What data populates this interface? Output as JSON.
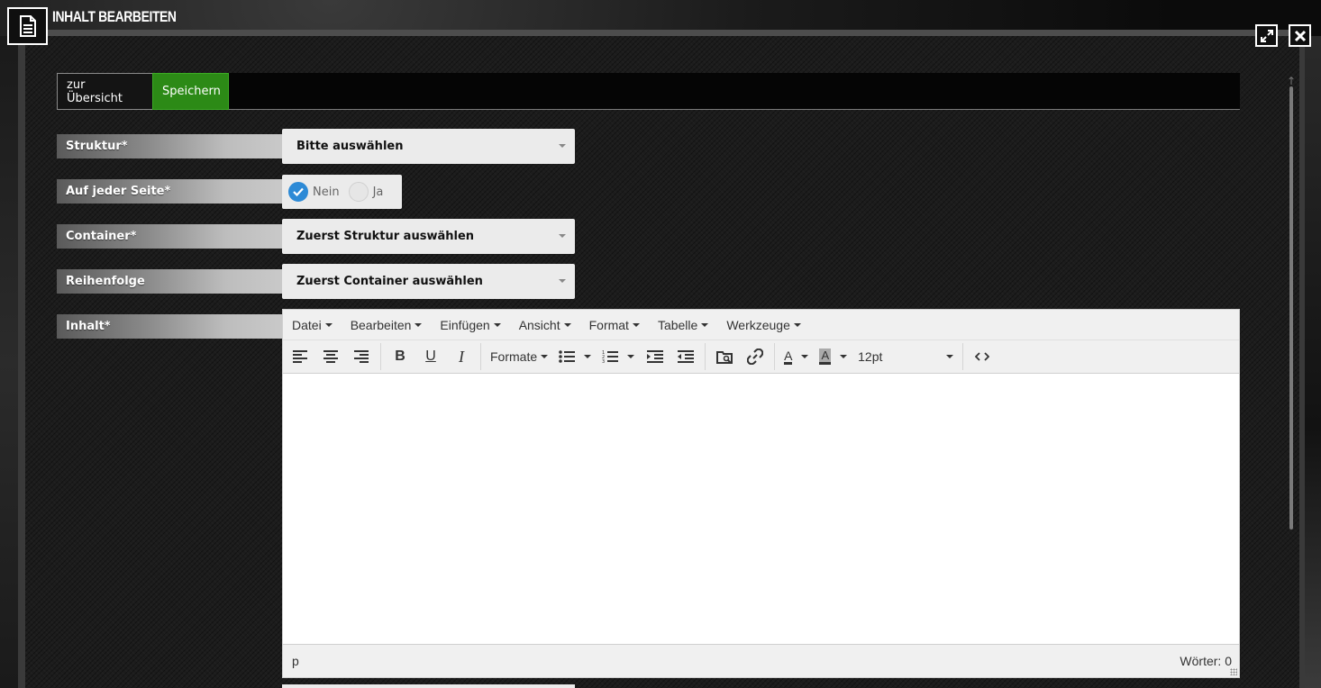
{
  "window": {
    "title": "INHALT BEARBEITEN",
    "title_icon": "document-icon",
    "expand_icon": "expand-icon",
    "close_icon": "close-icon"
  },
  "tabs": {
    "overview_label": "zur Übersicht",
    "save_label": "Speichern",
    "save_color": "#2c8a16"
  },
  "form": {
    "struktur": {
      "label": "Struktur*",
      "value": "Bitte auswählen"
    },
    "jede_seite": {
      "label": "Auf jeder Seite*",
      "options": [
        "Nein",
        "Ja"
      ],
      "selected": "Nein"
    },
    "container": {
      "label": "Container*",
      "value": "Zuerst Struktur auswählen"
    },
    "reihenfolge": {
      "label": "Reihenfolge",
      "value": "Zuerst Container auswählen"
    },
    "inhalt": {
      "label": "Inhalt*"
    }
  },
  "editor": {
    "menus": [
      "Datei",
      "Bearbeiten",
      "Einfügen",
      "Ansicht",
      "Format",
      "Tabelle",
      "Werkzeuge"
    ],
    "formats_label": "Formate",
    "font_size": "12pt",
    "status_path": "p",
    "word_count": "Wörter: 0",
    "accent_color": "#2d8ad6"
  }
}
